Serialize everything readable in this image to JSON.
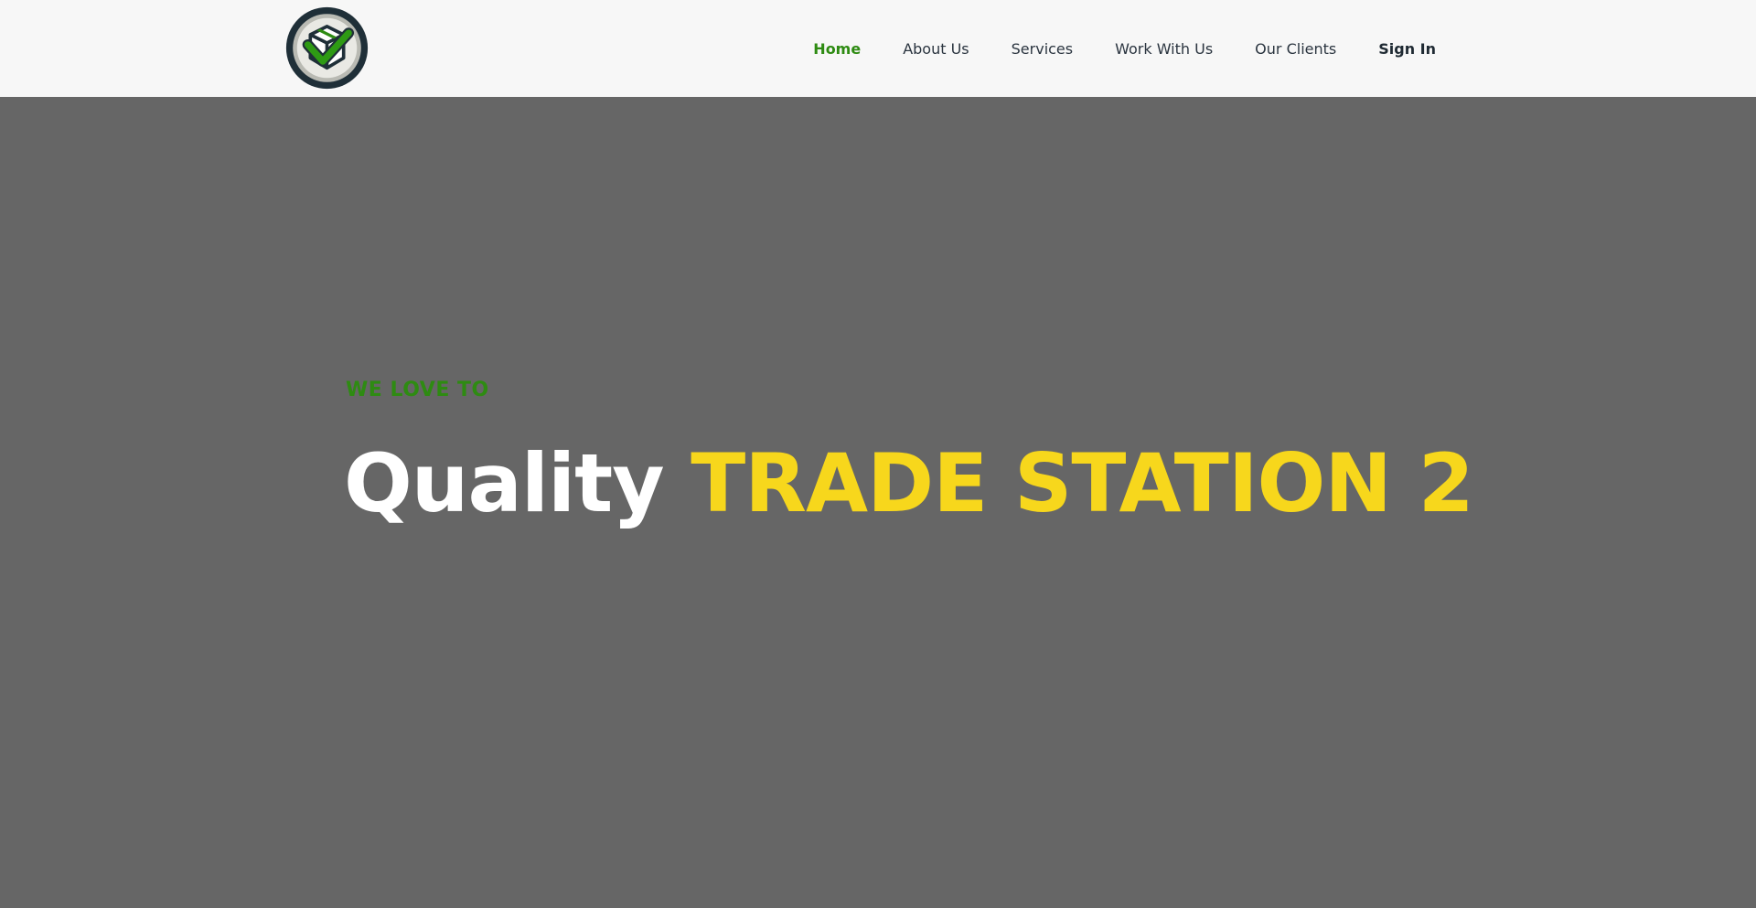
{
  "header": {
    "logo_icon": "box-checkmark-logo-icon",
    "nav": [
      {
        "label": "Home",
        "active": true
      },
      {
        "label": "About Us"
      },
      {
        "label": "Services"
      },
      {
        "label": "Work With Us"
      },
      {
        "label": "Our Clients"
      },
      {
        "label": "Sign In"
      }
    ]
  },
  "hero": {
    "eyebrow": "WE LOVE TO",
    "headline_part1": "Quality",
    "headline_part2": "TRADE STATION 2"
  },
  "colors": {
    "accent_green": "#2e8b12",
    "accent_yellow": "#f7d71c",
    "hero_background": "#666666",
    "header_background": "#f7f7f7"
  }
}
